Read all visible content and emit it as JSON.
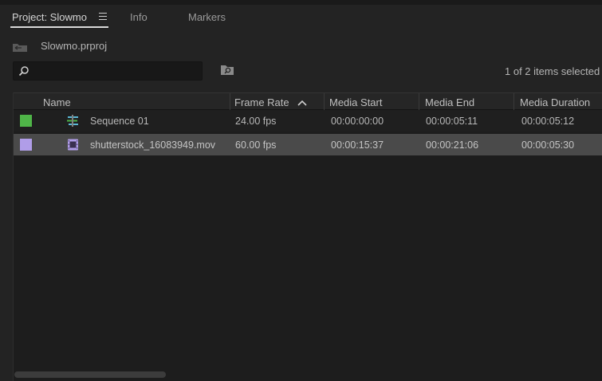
{
  "tabs": [
    {
      "label": "Project: Slowmo"
    },
    {
      "label": "Info"
    },
    {
      "label": "Markers"
    }
  ],
  "project": {
    "filename": "Slowmo.prproj"
  },
  "search": {
    "value": "",
    "placeholder": ""
  },
  "selection_status": "1 of 2 items selected",
  "table": {
    "columns": [
      "Name",
      "Frame Rate",
      "Media Start",
      "Media End",
      "Media Duration"
    ],
    "sort": {
      "column": "Frame Rate",
      "direction": "ascending"
    },
    "rows": [
      {
        "label_color": "#4fb548",
        "icon": "sequence-icon",
        "name": "Sequence 01",
        "frame_rate": "24.00 fps",
        "media_start": "00:00:00:00",
        "media_end": "00:00:05:11",
        "media_duration": "00:00:05:12",
        "selected": false
      },
      {
        "label_color": "#b09de8",
        "icon": "video-clip-icon",
        "name": "shutterstock_16083949.mov",
        "frame_rate": "60.00 fps",
        "media_start": "00:00:15:37",
        "media_end": "00:00:21:06",
        "media_duration": "00:00:05:30",
        "selected": true
      }
    ]
  },
  "colors": {
    "panel_bg": "#232323",
    "selected_row": "#4a4a4a",
    "accent_text": "#d4d4d4"
  }
}
